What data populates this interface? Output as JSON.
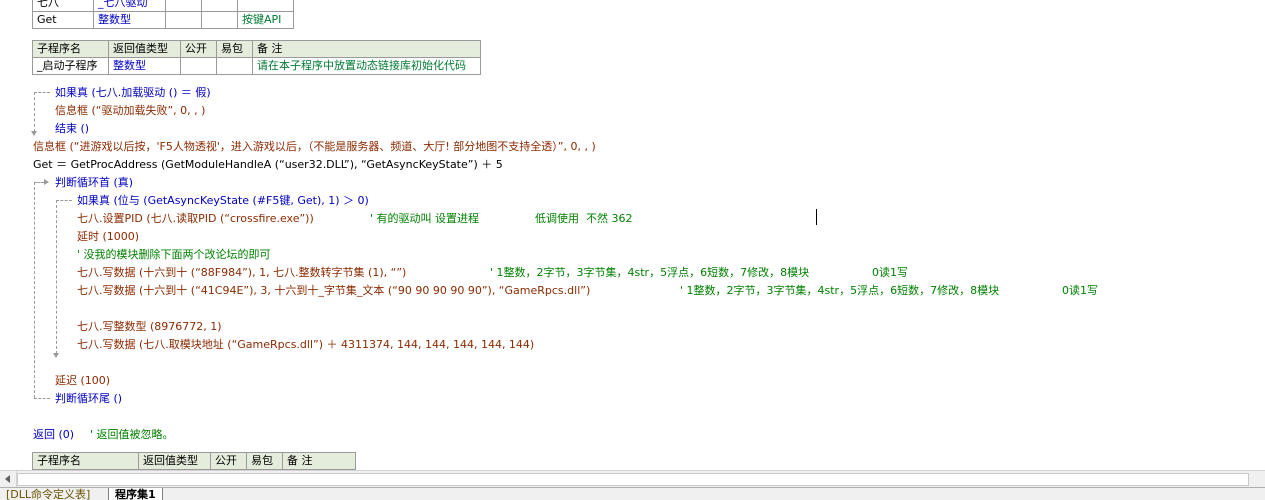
{
  "top_table": {
    "rows": [
      [
        "七八",
        "_七八驱动",
        "",
        "",
        ""
      ],
      [
        "Get",
        "整数型",
        "",
        "",
        "按键API"
      ]
    ]
  },
  "sub_table": {
    "headers": [
      "子程序名",
      "返回值类型",
      "公开",
      "易包",
      "备 注"
    ],
    "row": [
      "_启动子程序",
      "整数型",
      "",
      "",
      "请在本子程序中放置动态链接库初始化代码"
    ]
  },
  "code": {
    "l1": "如果真 (七八.加载驱动 () ＝ 假)",
    "l2": "信息框 (“驱动加载失败”, 0, , )",
    "l3": "结束 ()",
    "l4": "信息框 (“进游戏以后按，'F5人物透视'，进入游戏以后，（不能是服务器、频道、大厅! 部分地图不支持全透）”, 0, , )",
    "l5": "Get ＝ GetProcAddress (GetModuleHandleA (“user32.DLL”), “GetAsyncKeyState”) ＋ 5",
    "l6": "判断循环首 (真)",
    "l7": "如果真 (位与 (GetAsyncKeyState (#F5键, Get), 1) ＞ 0)",
    "l8_code": "七八.设置PID (七八.读取PID (“crossfire.exe”))",
    "l8_comment": "' 有的驱动叫 设置进程                低调使用  不然 362",
    "l9": "延时 (1000)",
    "l10": "' 没我的模块删除下面两个改论坛的即可",
    "l11_code": "七八.写数据 (十六到十 (“88F984”), 1, 七八.整数转字节集 (1), “”)",
    "l11_comment": "' 1整数，2字节，3字节集，4str，5浮点，6短数，7修改，8模块                  0读1写",
    "l12_code": "七八.写数据 (十六到十 (“41C94E”), 3, 十六到十_字节集_文本 (“90 90 90 90 90”), “GameRpcs.dll”)",
    "l12_comment": "' 1整数，2字节，3字节集，4str，5浮点，6短数，7修改，8模块                  0读1写",
    "l13": "七八.写整数型 (8976772, 1)",
    "l14": "七八.写数据 (七八.取模块地址 (“GameRpcs.dll”) ＋ 4311374, 144, 144, 144, 144, 144)",
    "l15": "延迟 (100)",
    "l16": "判断循环尾 ()",
    "l17_code": "返回 (0)",
    "l17_comment": "' 返回值被忽略。"
  },
  "bottom_table": {
    "headers": [
      "子程序名",
      "返回值类型",
      "公开",
      "易包",
      "备 注"
    ]
  },
  "tabs": {
    "tab1": "[DLL命令定义表]",
    "tab2": "程序集1"
  },
  "colors": {
    "keyword": "#0000c0",
    "function": "#8b2a00",
    "comment": "#008000",
    "table_header_bg": "#e4ecdc"
  }
}
